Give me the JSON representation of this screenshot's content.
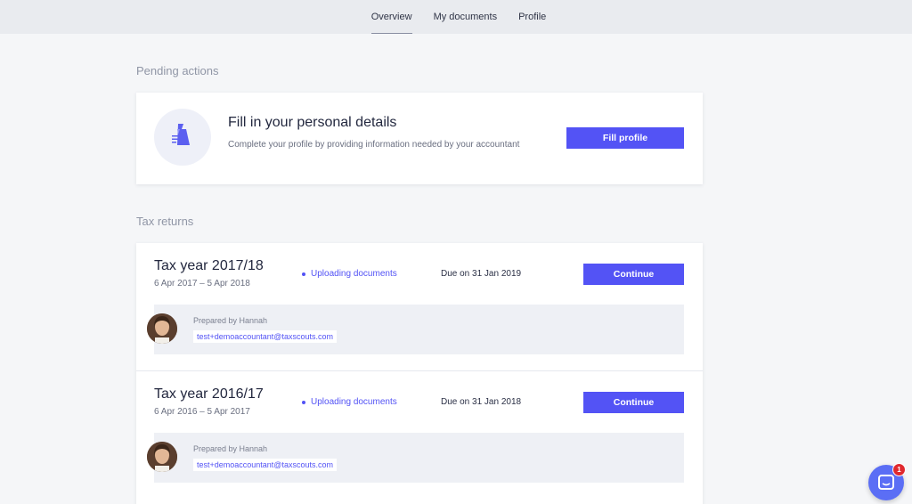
{
  "nav": {
    "tabs": [
      {
        "label": "Overview",
        "active": true
      },
      {
        "label": "My documents",
        "active": false
      },
      {
        "label": "Profile",
        "active": false
      }
    ]
  },
  "pending": {
    "section_label": "Pending actions",
    "icon": "profile-document-icon",
    "title": "Fill in your personal details",
    "description": "Complete your profile by providing information needed by your accountant",
    "button_label": "Fill profile"
  },
  "tax_returns": {
    "section_label": "Tax returns",
    "items": [
      {
        "year": "Tax year 2017/18",
        "range": "6 Apr 2017 – 5 Apr 2018",
        "status": "Uploading documents",
        "due": "Due on 31 Jan 2019",
        "button_label": "Continue",
        "prepared_by": "Prepared by Hannah",
        "email": "test+demoaccountant@taxscouts.com"
      },
      {
        "year": "Tax year 2016/17",
        "range": "6 Apr 2016 – 5 Apr 2017",
        "status": "Uploading documents",
        "due": "Due on 31 Jan 2018",
        "button_label": "Continue",
        "prepared_by": "Prepared by Hannah",
        "email": "test+demoaccountant@taxscouts.com"
      }
    ]
  },
  "chat": {
    "icon": "chat-icon",
    "badge_count": "1"
  },
  "colors": {
    "accent": "#5353f5",
    "badge": "#e0282e",
    "nav_bg": "#e9ebef"
  }
}
